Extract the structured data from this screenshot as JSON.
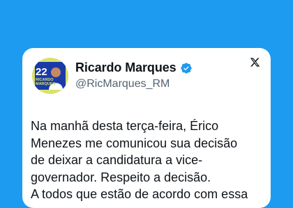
{
  "colors": {
    "background": "#1d9bf0",
    "card": "#ffffff",
    "verified": "#1d9bf0",
    "text": "#0f1419",
    "muted": "#536471",
    "avatar_bg": "#d9e26a",
    "avatar_accent": "#1a3aa8"
  },
  "author": {
    "display_name": "Ricardo Marques",
    "handle": "@RicMarques_RM",
    "verified_icon": "verified-badge-icon",
    "avatar": {
      "number": "22",
      "name_line1": "RICARDO",
      "name_line2": "MARQUES"
    }
  },
  "platform_icon": "x-logo-icon",
  "tweet": {
    "lines": [
      "Na manhã desta terça-feira, Érico",
      "Menezes me comunicou sua decisão",
      "de deixar a candidatura a vice-",
      "governador. Respeito a decisão.",
      "A todos que estão de acordo com essa"
    ]
  }
}
